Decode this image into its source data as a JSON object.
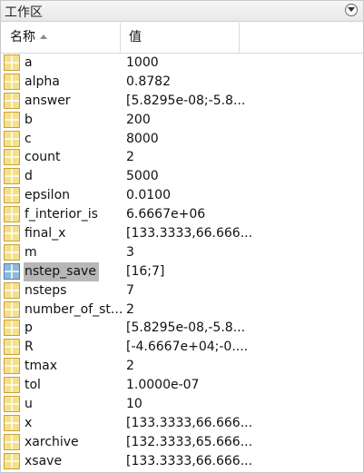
{
  "panel": {
    "title": "工作区"
  },
  "header": {
    "name_label": "名称",
    "value_label": "值"
  },
  "colors": {
    "icon_fill": "#f4e08a",
    "icon_border": "#c9a23a",
    "icon_selected_fill": "#8fb8de",
    "selected_row": "#b7b7b7"
  },
  "variables": [
    {
      "name": "a",
      "value": "1000"
    },
    {
      "name": "alpha",
      "value": "0.8782"
    },
    {
      "name": "answer",
      "value": "[5.8295e-08;-5.8..."
    },
    {
      "name": "b",
      "value": "200"
    },
    {
      "name": "c",
      "value": "8000"
    },
    {
      "name": "count",
      "value": "2"
    },
    {
      "name": "d",
      "value": "5000"
    },
    {
      "name": "epsilon",
      "value": "0.0100"
    },
    {
      "name": "f_interior_is",
      "value": "6.6667e+06"
    },
    {
      "name": "final_x",
      "value": "[133.3333,66.666..."
    },
    {
      "name": "m",
      "value": "3"
    },
    {
      "name": "nstep_save",
      "value": "[16;7]",
      "selected": true
    },
    {
      "name": "nsteps",
      "value": "7"
    },
    {
      "name": "number_of_st...",
      "value": "2"
    },
    {
      "name": "p",
      "value": "[5.8295e-08,-5.8..."
    },
    {
      "name": "R",
      "value": "[-4.6667e+04;-0...."
    },
    {
      "name": "tmax",
      "value": "2"
    },
    {
      "name": "tol",
      "value": "1.0000e-07"
    },
    {
      "name": "u",
      "value": "10"
    },
    {
      "name": "x",
      "value": "[133.3333,66.666..."
    },
    {
      "name": "xarchive",
      "value": "[132.3333,65.666..."
    },
    {
      "name": "xsave",
      "value": "[133.3333,66.666..."
    }
  ]
}
